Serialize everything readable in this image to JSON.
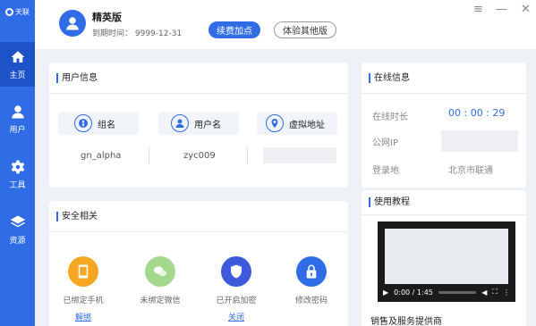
{
  "app": {
    "name": "天联"
  },
  "sidebar": {
    "items": [
      {
        "label": "主页",
        "icon": "home-icon"
      },
      {
        "label": "用户",
        "icon": "user-icon"
      },
      {
        "label": "工具",
        "icon": "gear-icon"
      },
      {
        "label": "资源",
        "icon": "layers-icon"
      }
    ]
  },
  "header": {
    "edition": "精英版",
    "expiry": "到期时间：  9999-12-31",
    "renew_label": "续费加点",
    "other_label": "体验其他版",
    "menu_glyph": "≡",
    "min_glyph": "—",
    "close_glyph": "✕"
  },
  "user_info": {
    "title": "用户信息",
    "fields": [
      {
        "label": "组名",
        "value": "gn_alpha",
        "icon": "globe-icon"
      },
      {
        "label": "用户名",
        "value": "zyc009",
        "icon": "user-icon"
      },
      {
        "label": "虚拟地址",
        "value": "",
        "icon": "ip-pin-icon"
      }
    ]
  },
  "security": {
    "title": "安全相关",
    "items": [
      {
        "label": "已绑定手机",
        "action": "解绑",
        "icon": "phone-icon",
        "color": "#f5a623"
      },
      {
        "label": "未绑定微信",
        "action": "",
        "icon": "wechat-icon",
        "color": "#a3d98c"
      },
      {
        "label": "已开启加密",
        "action": "关闭",
        "icon": "shield-icon",
        "color": "#3b5bdb"
      },
      {
        "label": "修改密码",
        "action": "",
        "icon": "lock-icon",
        "color": "#2f6ce5"
      }
    ]
  },
  "online": {
    "title": "在线信息",
    "duration_label": "在线时长",
    "duration_value": "00 : 00 : 29",
    "ip_label": "公网IP",
    "location_label": "登录地",
    "location_value": "北京市联通"
  },
  "tutorial": {
    "title": "使用教程",
    "video_time": "0:00 / 1:45"
  },
  "footer": {
    "label": "销售及服务提供商"
  },
  "colors": {
    "accent": "#2f6ce5",
    "sidebar_active": "#1d53c6"
  }
}
